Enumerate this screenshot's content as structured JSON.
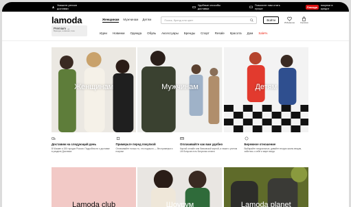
{
  "topbar": {
    "left": "Укажите регион доставки",
    "mid1": "Удобные способы доставки",
    "mid2": "Помогите нам стать лучше",
    "brand": "Ламода",
    "brand_suffix": "покупки в кредит"
  },
  "header": {
    "logo": "lamoda",
    "tabs": [
      "Женщинам",
      "Мужчинам",
      "Детям"
    ],
    "search_placeholder": "Поиск, бренд или цвет",
    "login_label": "Войти",
    "icons": [
      {
        "name": "heart-icon",
        "label": "Избранное"
      },
      {
        "name": "bag-icon",
        "label": "Корзина"
      }
    ]
  },
  "nav": {
    "premium_title": "Premium →",
    "premium_sub": "Бренды, новинки, luxe",
    "categories": [
      "Идеи",
      "Новинки",
      "Одежда",
      "Обувь",
      "Аксессуары",
      "Бренды",
      "Спорт",
      "Resale",
      "Красота",
      "Дом",
      "Sale%"
    ]
  },
  "hero": [
    {
      "label": "Женщинам",
      "color": "#5e7d3a"
    },
    {
      "label": "Мужчинам",
      "color": "#7d7d78"
    },
    {
      "label": "Детям",
      "color": "#e23a2e"
    }
  ],
  "info": [
    {
      "icon": "truck-icon",
      "title": "Доставим на следующий день",
      "text": "В Москве и 150 городах России. Подробности о доставке в разделе Доставка"
    },
    {
      "icon": "box-icon",
      "title": "Примерьте перед покупкой",
      "text": "Оплачивайте только то, что подошло — без примерки и покупки"
    },
    {
      "icon": "card-icon",
      "title": "Оплачивайте как вам удобно",
      "text": "Картой онлайн или банковской картой, а также с учетом LM бонусов есть бонусная оплата"
    },
    {
      "icon": "smile-icon",
      "title": "Бережное отношение",
      "text": "Выбирайте натуральные, давайте вторую жизнь вещам, заботясь о себе и мире вокруг"
    }
  ],
  "bottom": [
    {
      "label": "Lamoda club",
      "color": "#f2c9c6"
    },
    {
      "label": "Шоурум",
      "color": "#cfc6bf"
    },
    {
      "label": "Lamoda planet",
      "color": "#6b7a2e"
    }
  ]
}
